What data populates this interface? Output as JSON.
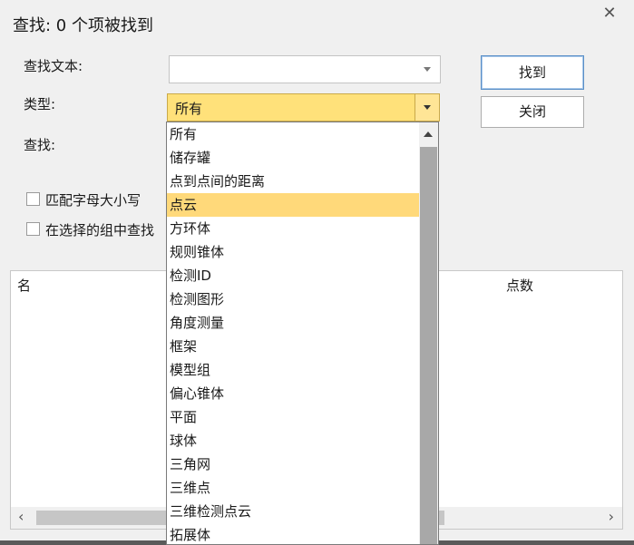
{
  "dialog": {
    "title": "查找: 0 个项被找到",
    "close_glyph": "✕"
  },
  "form": {
    "find_text_label": "查找文本:",
    "find_text_value": "",
    "type_label": "类型:",
    "type_value": "所有",
    "find_in_label": "查找:",
    "match_case_label": "匹配字母大小写",
    "search_in_selection_label": "在选择的组中查找"
  },
  "buttons": {
    "find_label": "找到",
    "close_label": "关闭"
  },
  "results": {
    "columns": [
      "名",
      "点数"
    ]
  },
  "dropdown": {
    "selected_index": 3,
    "items": [
      "所有",
      "储存罐",
      "点到点间的距离",
      "点云",
      "方环体",
      "规则锥体",
      "检测ID",
      "检测图形",
      "角度测量",
      "框架",
      "模型组",
      "偏心锥体",
      "平面",
      "球体",
      "三角网",
      "三维点",
      "三维检测点云",
      "拓展体"
    ]
  },
  "icons": {
    "close": "close-icon",
    "scroll_left": "chevron-left-icon",
    "scroll_right": "chevron-right-icon",
    "scroll_up": "chevron-up-icon",
    "combo_arrow": "chevron-down-icon"
  },
  "colors": {
    "highlight": "#ffd97a",
    "combo_active": "#ffe17a",
    "primary_border": "#5a8fc7"
  }
}
